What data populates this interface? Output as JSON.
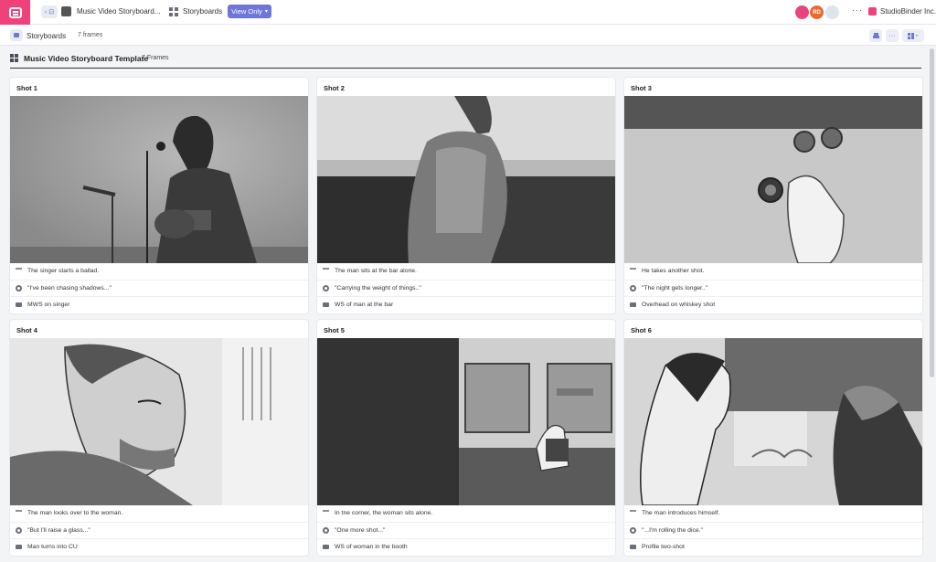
{
  "topbar": {
    "back_label": "‹ ⊡",
    "project_name": "Music Video Storyboard...",
    "storyboards_label": "Storyboards",
    "view_button": "View Only",
    "avatars": [
      {
        "initials": "",
        "color": "#e8457a"
      },
      {
        "initials": "RD",
        "color": "#e86a2c"
      },
      {
        "initials": "",
        "color": "#dfe3ea"
      }
    ],
    "more": "···",
    "company": "StudioBinder Inc."
  },
  "subbar": {
    "title": "Storyboards",
    "count": "7 frames",
    "more": "···"
  },
  "section": {
    "title": "Music Video Storyboard Template",
    "count": "7 Frames"
  },
  "colors": {
    "brand": "#f0427a",
    "accent": "#6c77d8"
  },
  "shots": [
    {
      "title": "Shot  1",
      "description": "The singer starts a ballad.",
      "dialogue": "\"I've been chasing shadows...\"",
      "camera": "MWS on singer"
    },
    {
      "title": "Shot  2",
      "description": "The man sits at the bar alone.",
      "dialogue": "\"Carrying the weight of things..\"",
      "camera": "WS of man at the bar"
    },
    {
      "title": "Shot  3",
      "description": "He takes another shot.",
      "dialogue": "\"The night gets longer..\"",
      "camera": "Overhead on whiskey shot"
    },
    {
      "title": "Shot  4",
      "description": "The man looks over to the woman.",
      "dialogue": "\"But I'll raise a glass...\"",
      "camera": "Man turns into CU"
    },
    {
      "title": "Shot  5",
      "description": "In tne corner, the woman sits alone.",
      "dialogue": "\"One more shot...\"",
      "camera": "WS of woman in the booth"
    },
    {
      "title": "Shot  6",
      "description": "The man introduces himself.",
      "dialogue": "\"...I'm rolling the dice.\"",
      "camera": "Profile two-shot"
    }
  ]
}
